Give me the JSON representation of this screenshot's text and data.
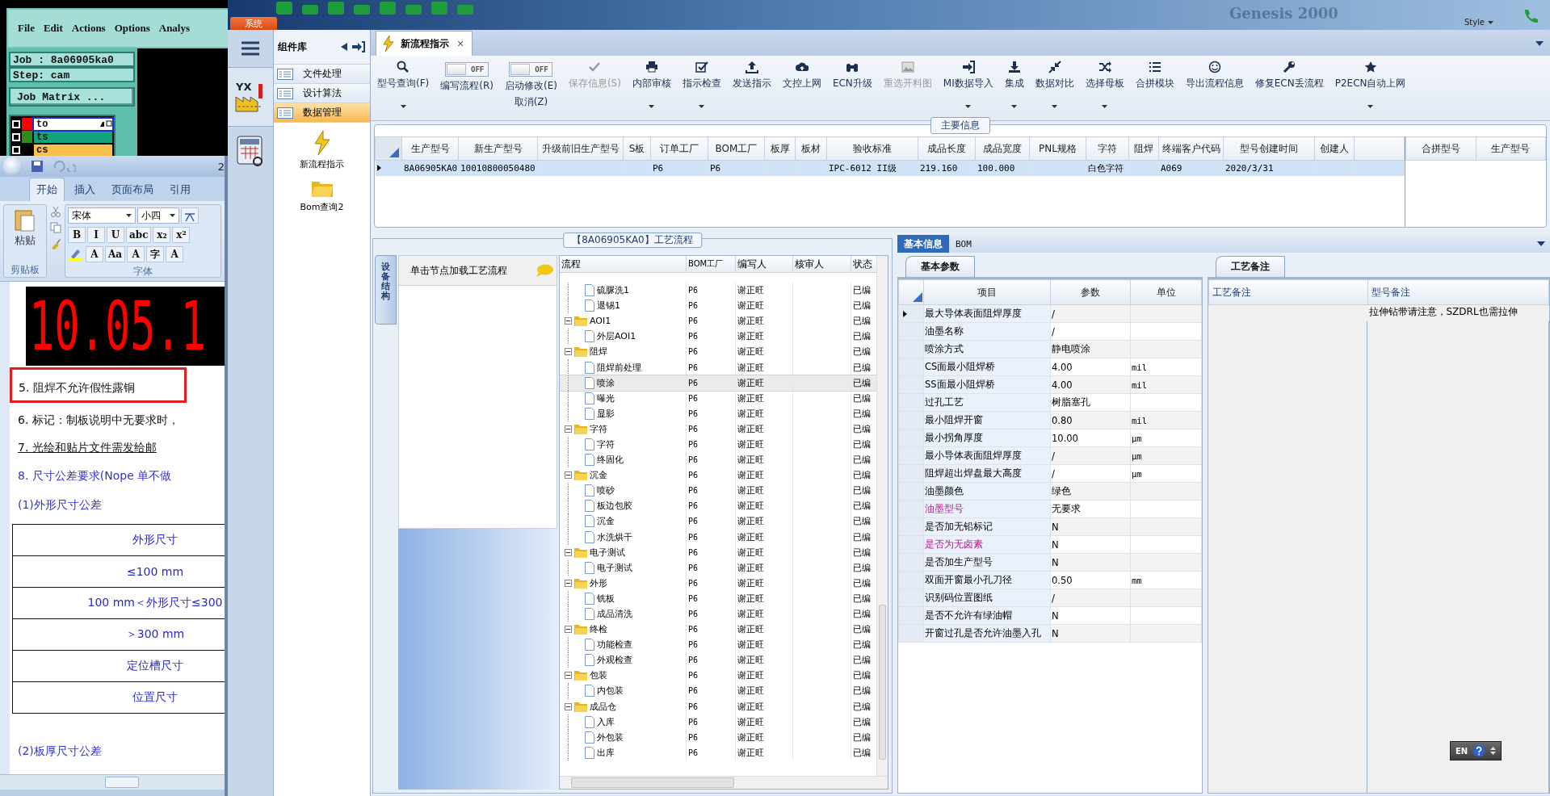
{
  "genesis": {
    "menu": [
      "File",
      "Edit",
      "Actions",
      "Options",
      "Analys"
    ],
    "job": "Job : 8a06905ka0",
    "step": "Step: cam",
    "matrix_button": "Job Matrix ...",
    "layers": [
      {
        "name": "to",
        "color": "#ffffff",
        "swatch": {
          "color": "#ff0000"
        },
        "checked": false,
        "selected": true
      },
      {
        "name": "ts",
        "color": "#13a37a",
        "swatch": {
          "color": "#2e8b1e"
        },
        "checked": false,
        "selected": false
      },
      {
        "name": "cs",
        "color": "#f9c04f",
        "checked": false,
        "selected": false
      }
    ]
  },
  "word": {
    "title": "2",
    "tabs": [
      {
        "label": "开始",
        "selected": true
      },
      {
        "label": "插入",
        "selected": false
      },
      {
        "label": "页面布局",
        "selected": false
      },
      {
        "label": "引用",
        "selected": false
      }
    ],
    "paste": "粘贴",
    "font_name": "宋体",
    "font_size": "小四",
    "format_buttons": [
      "B",
      "I",
      "U",
      "abc",
      "x₂",
      "x²"
    ],
    "format_buttons_2": [
      "A",
      "Aa",
      "A",
      "字",
      "A"
    ],
    "groups": [
      "剪贴板",
      "字体"
    ],
    "image_text": "10.05.1",
    "lines": [
      {
        "text": "5. 阻焊不允许假性露铜",
        "kind": "boxed"
      },
      {
        "text": "6.  标记：制板说明中无要求时，",
        "kind": "plain"
      },
      {
        "text": "7.  光绘和贴片文件需发给邮",
        "kind": "underlined"
      },
      {
        "text": "8. 尺寸公差要求(Nope 单不做",
        "kind": "heading"
      },
      {
        "text": "(1)外形尺寸公差",
        "kind": "heading"
      }
    ],
    "table": [
      "外形尺寸",
      "≤100 mm",
      "100 mm＜外形尺寸≤300",
      "＞300 mm",
      "定位槽尺寸",
      "位置尺寸"
    ],
    "after": "(2)板厚尺寸公差"
  },
  "app": {
    "system_tab": "系统",
    "banner": "Genesis 2000",
    "style": "Style",
    "nav_logo": "YX",
    "library": {
      "title": "组件库",
      "categories": [
        {
          "label": "文件处理",
          "selected": false
        },
        {
          "label": "设计算法",
          "selected": false
        },
        {
          "label": "数据管理",
          "selected": true
        }
      ],
      "items": [
        "新流程指示",
        "Bom查询2"
      ]
    },
    "doc_tab": {
      "label": "新流程指示",
      "close": "×"
    },
    "ribbon": [
      {
        "kind": "button",
        "label": "型号查询(F)",
        "disabled": false,
        "dropdown": true
      },
      {
        "kind": "toggle",
        "label": "编写流程(R)",
        "switch_text": "OFF",
        "on": false
      },
      {
        "kind": "toggle",
        "label": "启动修改(E)",
        "label2": "取消(Z)",
        "switch_text": "OFF",
        "on": false
      },
      {
        "kind": "button",
        "label": "保存信息(S)",
        "disabled": true,
        "dropdown": false
      },
      {
        "kind": "button",
        "label": "内部审核",
        "disabled": false,
        "dropdown": true
      },
      {
        "kind": "button",
        "label": "指示检查",
        "disabled": false,
        "dropdown": true
      },
      {
        "kind": "button",
        "label": "发送指示",
        "disabled": false,
        "dropdown": false
      },
      {
        "kind": "button",
        "label": "文控上网",
        "disabled": false,
        "dropdown": false
      },
      {
        "kind": "button",
        "label": "ECN升级",
        "disabled": false,
        "dropdown": false
      },
      {
        "kind": "button",
        "label": "重选开料图",
        "disabled": true,
        "dropdown": false
      },
      {
        "kind": "button",
        "label": "MI数据导入",
        "disabled": false,
        "dropdown": true
      },
      {
        "kind": "button",
        "label": "集成",
        "disabled": false,
        "dropdown": true
      },
      {
        "kind": "button",
        "label": "数据对比",
        "disabled": false,
        "dropdown": true
      },
      {
        "kind": "button",
        "label": "选择母板",
        "disabled": false,
        "dropdown": true
      },
      {
        "kind": "button",
        "label": "合拼模块",
        "disabled": false,
        "dropdown": false
      },
      {
        "kind": "button",
        "label": "导出流程信息",
        "disabled": false,
        "dropdown": false
      },
      {
        "kind": "button",
        "label": "修复ECN丢流程",
        "disabled": false,
        "dropdown": false
      },
      {
        "kind": "button",
        "label": "P2ECN自动上网",
        "disabled": false,
        "dropdown": true
      }
    ],
    "info": {
      "title": "主要信息",
      "columns": [
        "生产型号",
        "新生产型号",
        "升级前旧生产型号",
        "S板",
        "订单工厂",
        "BOM工厂",
        "板厚",
        "板材",
        "验收标准",
        "成品长度",
        "成品宽度",
        "PNL规格",
        "字符",
        "阻焊",
        "终端客户代码",
        "型号创建时间",
        "创建人"
      ],
      "rows": [
        {
          "selected": true,
          "cells": [
            "8A06905KA0",
            "10010800050480",
            null,
            null,
            "P6",
            "P6",
            null,
            null,
            "IPC-6012 II级",
            "219.160",
            "100.000",
            null,
            "白色字符",
            null,
            "A069",
            "2020/3/31",
            null
          ]
        }
      ],
      "side_columns": [
        "合拼型号",
        "生产型号"
      ]
    },
    "flow": {
      "title": "【8A06905KA0】工艺流程",
      "side_tab": "设备结构",
      "hint": "单击节点加载工艺流程",
      "columns": [
        "流程",
        "BOM工厂",
        "编写人",
        "核审人",
        "状态"
      ],
      "tree": [
        {
          "children": [
            {
              "label": "硫脲洗1",
              "bom": "P6",
              "writer": "谢正旺",
              "status": "已编",
              "selected": false
            },
            {
              "label": "退锡1",
              "bom": "P6",
              "writer": "谢正旺",
              "status": "已编",
              "selected": false
            }
          ]
        },
        {
          "label": "AOI1",
          "bom": "P6",
          "writer": "谢正旺",
          "status": "已编",
          "expanded": true,
          "selected": false,
          "children": [
            {
              "label": "外层AOI1",
              "bom": "P6",
              "writer": "谢正旺",
              "status": "已编",
              "selected": false
            }
          ]
        },
        {
          "label": "阻焊",
          "bom": "P6",
          "writer": "谢正旺",
          "status": "已编",
          "expanded": true,
          "selected": false,
          "children": [
            {
              "label": "阻焊前处理",
              "bom": "P6",
              "writer": "谢正旺",
              "status": "已编",
              "selected": false
            },
            {
              "label": "喷涂",
              "bom": "P6",
              "writer": "谢正旺",
              "status": "已编",
              "selected": true
            },
            {
              "label": "曝光",
              "bom": "P6",
              "writer": "谢正旺",
              "status": "已编",
              "selected": false
            },
            {
              "label": "显影",
              "bom": "P6",
              "writer": "谢正旺",
              "status": "已编",
              "selected": false
            }
          ]
        },
        {
          "label": "字符",
          "bom": "P6",
          "writer": "谢正旺",
          "status": "已编",
          "expanded": true,
          "selected": false,
          "children": [
            {
              "label": "字符",
              "bom": "P6",
              "writer": "谢正旺",
              "status": "已编",
              "selected": false
            },
            {
              "label": "终固化",
              "bom": "P6",
              "writer": "谢正旺",
              "status": "已编",
              "selected": false
            }
          ]
        },
        {
          "label": "沉金",
          "bom": "P6",
          "writer": "谢正旺",
          "status": "已编",
          "expanded": true,
          "selected": false,
          "children": [
            {
              "label": "喷砂",
              "bom": "P6",
              "writer": "谢正旺",
              "status": "已编",
              "selected": false
            },
            {
              "label": "板边包胶",
              "bom": "P6",
              "writer": "谢正旺",
              "status": "已编",
              "selected": false
            },
            {
              "label": "沉金",
              "bom": "P6",
              "writer": "谢正旺",
              "status": "已编",
              "selected": false
            },
            {
              "label": "水洗烘干",
              "bom": "P6",
              "writer": "谢正旺",
              "status": "已编",
              "selected": false
            }
          ]
        },
        {
          "label": "电子测试",
          "bom": "P6",
          "writer": "谢正旺",
          "status": "已编",
          "expanded": true,
          "selected": false,
          "children": [
            {
              "label": "电子测试",
              "bom": "P6",
              "writer": "谢正旺",
              "status": "已编",
              "selected": false
            }
          ]
        },
        {
          "label": "外形",
          "bom": "P6",
          "writer": "谢正旺",
          "status": "已编",
          "expanded": true,
          "selected": false,
          "children": [
            {
              "label": "铣板",
              "bom": "P6",
              "writer": "谢正旺",
              "status": "已编",
              "selected": false
            },
            {
              "label": "成品清洗",
              "bom": "P6",
              "writer": "谢正旺",
              "status": "已编",
              "selected": false
            }
          ]
        },
        {
          "label": "终检",
          "bom": "P6",
          "writer": "谢正旺",
          "status": "已编",
          "expanded": true,
          "selected": false,
          "children": [
            {
              "label": "功能检查",
              "bom": "P6",
              "writer": "谢正旺",
              "status": "已编",
              "selected": false
            },
            {
              "label": "外观检查",
              "bom": "P6",
              "writer": "谢正旺",
              "status": "已编",
              "selected": false
            }
          ]
        },
        {
          "label": "包装",
          "bom": "P6",
          "writer": "谢正旺",
          "status": "已编",
          "expanded": true,
          "selected": false,
          "children": [
            {
              "label": "内包装",
              "bom": "P6",
              "writer": "谢正旺",
              "status": "已编",
              "selected": false
            }
          ]
        },
        {
          "label": "成品仓",
          "bom": "P6",
          "writer": "谢正旺",
          "status": "已编",
          "expanded": true,
          "selected": false,
          "children": [
            {
              "label": "入库",
              "bom": "P6",
              "writer": "谢正旺",
              "status": "已编",
              "selected": false
            },
            {
              "label": "外包装",
              "bom": "P6",
              "writer": "谢正旺",
              "status": "已编",
              "selected": false
            },
            {
              "label": "出库",
              "bom": "P6",
              "writer": "谢正旺",
              "status": "已编",
              "selected": false
            }
          ]
        }
      ]
    },
    "detail": {
      "tabs": [
        {
          "label": "基本信息",
          "selected": true
        },
        {
          "label": "BOM",
          "selected": false
        }
      ],
      "params_tab": "基本参数",
      "notes_tab": "工艺备注",
      "param_columns": [
        "项目",
        "参数",
        "单位"
      ],
      "params": [
        {
          "item": "最大导体表面阻焊厚度",
          "value": "/",
          "current": true,
          "flagged": false
        },
        {
          "item": "油墨名称",
          "value": "/",
          "current": false,
          "flagged": false
        },
        {
          "item": "喷涂方式",
          "value": "静电喷涂",
          "current": false,
          "flagged": false
        },
        {
          "item": "CS面最小阻焊桥",
          "value": "4.00",
          "unit": "mil",
          "current": false,
          "flagged": false
        },
        {
          "item": "SS面最小阻焊桥",
          "value": "4.00",
          "unit": "mil",
          "current": false,
          "flagged": false
        },
        {
          "item": "过孔工艺",
          "value": "树脂塞孔",
          "current": false,
          "flagged": false
        },
        {
          "item": "最小阻焊开窗",
          "value": "0.80",
          "unit": "mil",
          "current": false,
          "flagged": false
        },
        {
          "item": "最小拐角厚度",
          "value": "10.00",
          "unit": "μm",
          "current": false,
          "flagged": false
        },
        {
          "item": "最小导体表面阻焊厚度",
          "value": "/",
          "unit": "μm",
          "current": false,
          "flagged": false
        },
        {
          "item": "阻焊超出焊盘最大高度",
          "value": "/",
          "unit": "μm",
          "current": false,
          "flagged": false
        },
        {
          "item": "油墨颜色",
          "value": "绿色",
          "current": false,
          "flagged": false
        },
        {
          "item": "油墨型号",
          "value": "无要求",
          "current": false,
          "flagged": true
        },
        {
          "item": "是否加无铅标记",
          "value": "N",
          "current": false,
          "flagged": false
        },
        {
          "item": "是否为无卤素",
          "value": "N",
          "current": false,
          "flagged": true
        },
        {
          "item": "是否加生产型号",
          "value": "N",
          "current": false,
          "flagged": false
        },
        {
          "item": "双面开窗最小孔刀径",
          "value": "0.50",
          "unit": "mm",
          "current": false,
          "flagged": false
        },
        {
          "item": "识别码位置图纸",
          "value": "/",
          "current": false,
          "flagged": false
        },
        {
          "item": "是否不允许有绿油帽",
          "value": "N",
          "current": false,
          "flagged": false
        },
        {
          "item": "开窗过孔是否允许油墨入孔",
          "value": "N",
          "current": false,
          "flagged": false
        }
      ],
      "note_columns": [
        "工艺备注",
        "型号备注"
      ],
      "notes": [
        {
          "model": "拉伸钻带请注意，SZDRL也需拉伸"
        }
      ]
    },
    "language": "EN"
  }
}
